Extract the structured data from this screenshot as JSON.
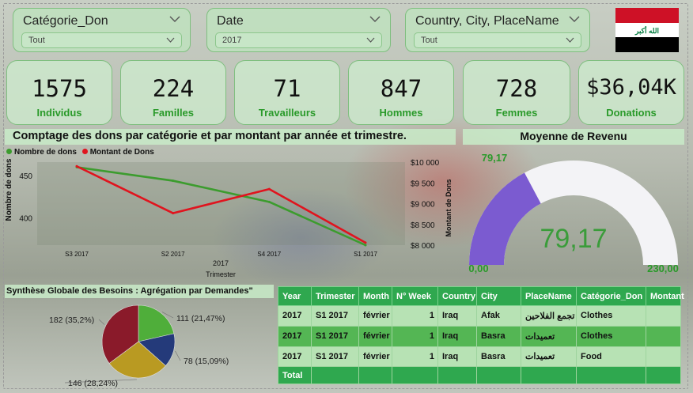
{
  "filters": [
    {
      "title": "Catégorie_Don",
      "value": "Tout"
    },
    {
      "title": "Date",
      "value": "2017"
    },
    {
      "title": "Country, City, PlaceName",
      "value": "Tout"
    }
  ],
  "flag": {
    "emblem_text": "الله أكبر",
    "colors": [
      "#ce1126",
      "#ffffff",
      "#000000",
      "#007a3d"
    ]
  },
  "kpis": [
    {
      "value": "1575",
      "label": "Individus"
    },
    {
      "value": "224",
      "label": "Familles"
    },
    {
      "value": "71",
      "label": "Travailleurs"
    },
    {
      "value": "847",
      "label": "Hommes"
    },
    {
      "value": "728",
      "label": "Femmes"
    },
    {
      "value": "$36,04K",
      "label": "Donations"
    }
  ],
  "line_section": {
    "title": "Comptage des dons par catégorie et par montant par année et trimestre."
  },
  "gauge_section": {
    "title": "Moyenne de Revenu"
  },
  "pie_section": {
    "title": "Synthèse Globale des Besoins : Agrégation par Demandes\""
  },
  "chart_data": [
    {
      "type": "line",
      "categories": [
        "S3 2017",
        "S2 2017",
        "S4 2017",
        "S1 2017"
      ],
      "x_sub_label": "2017",
      "xlabel": "Trimester",
      "ylabel": "Nombre de dons",
      "y2label": "Montant de Dons",
      "ylim": [
        368,
        466
      ],
      "y_ticks": [
        "450",
        "400"
      ],
      "y2lim": [
        8000,
        10000
      ],
      "y2_ticks": [
        "$10 000",
        "$9 500",
        "$9 000",
        "$8 500",
        "$8 000"
      ],
      "legend_position": "top-left",
      "series": [
        {
          "name": "Nombre de dons",
          "axis": "left",
          "color": "#3c9c2e",
          "values": [
            460,
            444,
            419,
            368
          ]
        },
        {
          "name": "Montant de Dons",
          "axis": "right",
          "color": "#e0141e",
          "values": [
            9900,
            8770,
            9350,
            8060
          ]
        }
      ]
    },
    {
      "type": "gauge",
      "value": 79.17,
      "value_label": "79,17",
      "top_label": "79,17",
      "min_label": "0,00",
      "max_label": "230,00",
      "min": 0,
      "max": 230,
      "fill_color": "#7b5bd0",
      "track_color": "#f3f3f6"
    },
    {
      "type": "pie",
      "slices": [
        {
          "value": 182,
          "label": "182 (35,2%)",
          "color": "#8a1a2a"
        },
        {
          "value": 111,
          "label": "111 (21,47%)",
          "color": "#4fae3a"
        },
        {
          "value": 78,
          "label": "78 (15,09%)",
          "color": "#243a7a"
        },
        {
          "value": 146,
          "label": "146 (28,24%)",
          "color": "#b99a22"
        }
      ]
    }
  ],
  "table": {
    "columns": [
      "Year",
      "Trimester",
      "Month",
      "N° Week",
      "Country",
      "City",
      "PlaceName",
      "Catégorie_Don",
      "Montant"
    ],
    "rows": [
      [
        "2017",
        "S1 2017",
        "février",
        "1",
        "Iraq",
        "Afak",
        "تجمع الفلاحين",
        "Clothes",
        ""
      ],
      [
        "2017",
        "S1 2017",
        "février",
        "1",
        "Iraq",
        "Basra",
        "تعميدات",
        "Clothes",
        ""
      ],
      [
        "2017",
        "S1 2017",
        "février",
        "1",
        "Iraq",
        "Basra",
        "تعميدات",
        "Food",
        ""
      ]
    ],
    "total_label": "Total"
  }
}
